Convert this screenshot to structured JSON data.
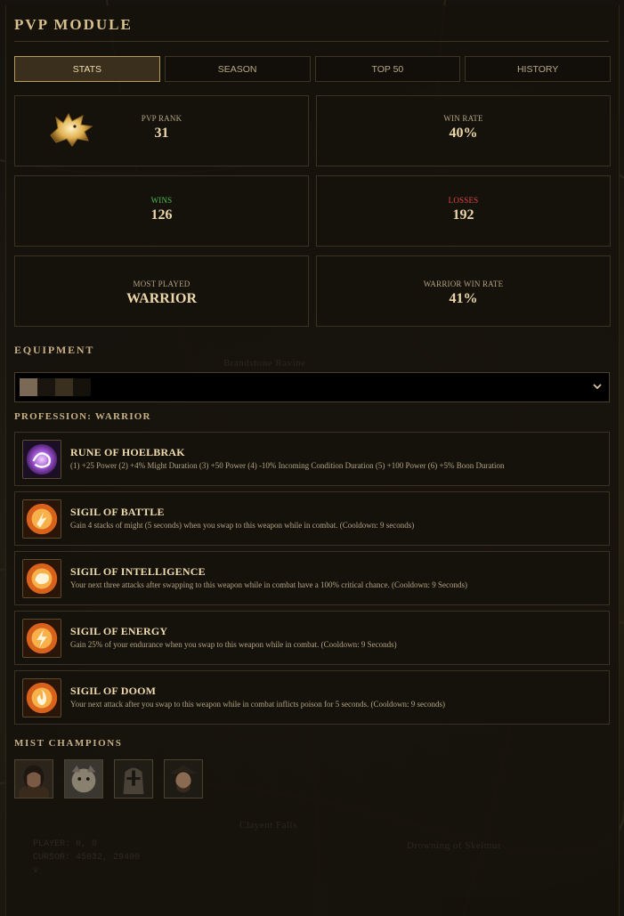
{
  "header": {
    "title": "PVP MODULE"
  },
  "tabs": [
    {
      "label": "STATS",
      "active": true
    },
    {
      "label": "SEASON",
      "active": false
    },
    {
      "label": "TOP 50",
      "active": false
    },
    {
      "label": "HISTORY",
      "active": false
    }
  ],
  "stats": {
    "pvp_rank": {
      "label": "PVP RANK",
      "value": "31",
      "icon": "wolf-emblem-icon"
    },
    "win_rate": {
      "label": "WIN RATE",
      "value": "40%"
    },
    "wins": {
      "label": "WINS",
      "value": "126",
      "color": "#4cbe4c"
    },
    "losses": {
      "label": "LOSSES",
      "value": "192",
      "color": "#e04848"
    },
    "most_played": {
      "label": "MOST PLAYED",
      "value": "WARRIOR"
    },
    "class_win_rate": {
      "label": "WARRIOR WIN RATE",
      "value": "41%"
    }
  },
  "equipment": {
    "heading": "EQUIPMENT",
    "selector_icon": "chevron-down-icon"
  },
  "profession": {
    "heading": "PROFESSION: WARRIOR",
    "items": [
      {
        "name": "RUNE OF HOELBRAK",
        "icon": "rune-icon",
        "description": "(1) +25 Power (2) +4% Might Duration (3) +50 Power (4) -10% Incoming Condition Duration (5) +100 Power (6) +5% Boon Duration"
      },
      {
        "name": "SIGIL OF BATTLE",
        "icon": "sigil-icon",
        "description": "Gain 4 stacks of might (5 seconds) when you swap to this weapon while in combat. (Cooldown: 9 seconds)"
      },
      {
        "name": "SIGIL OF INTELLIGENCE",
        "icon": "sigil-icon",
        "description": "Your next three attacks after swapping to this weapon while in combat have a 100% critical chance. (Cooldown: 9 Seconds)"
      },
      {
        "name": "SIGIL OF ENERGY",
        "icon": "sigil-icon",
        "description": "Gain 25% of your endurance when you swap to this weapon while in combat. (Cooldown: 9 Seconds)"
      },
      {
        "name": "SIGIL OF DOOM",
        "icon": "sigil-icon",
        "description": "Your next attack after you swap to this weapon while in combat inflicts poison for 5 seconds. (Cooldown: 9 seconds)"
      }
    ]
  },
  "champions": {
    "heading": "MIST CHAMPIONS",
    "portraits": [
      "champion-portrait-1",
      "champion-portrait-2",
      "champion-portrait-3",
      "champion-portrait-4"
    ]
  },
  "debug": {
    "player": "PLAYER: 0, 0",
    "cursor": "CURSOR: 45032, 29400",
    "extra": "v"
  },
  "map_labels": {
    "top": "Brandstone Ravine",
    "bottom_left": "Clayent Falls",
    "bottom_right": "Drowning of Skelmur"
  },
  "colors": {
    "accent": "#b99a5c",
    "wins": "#4cbe4c",
    "losses": "#e04848"
  }
}
